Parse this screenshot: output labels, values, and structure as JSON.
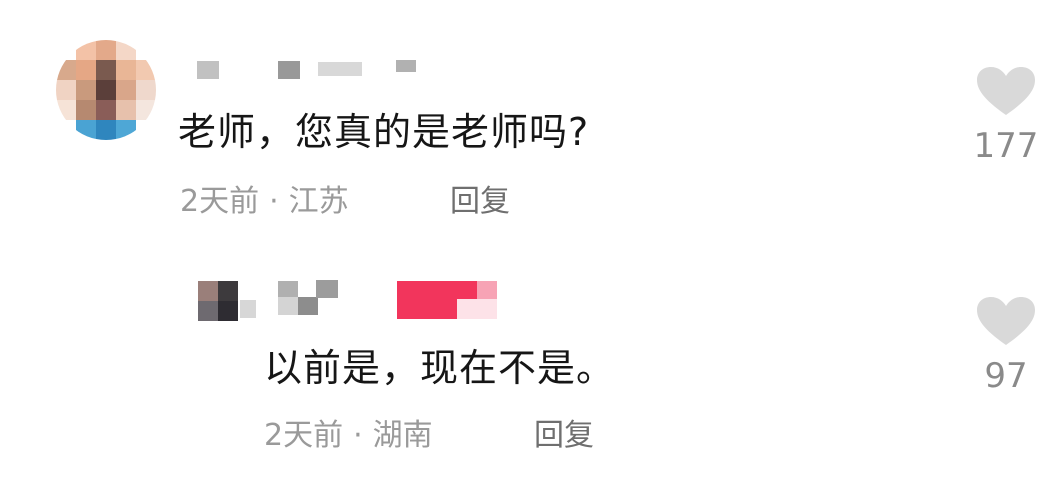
{
  "comments": [
    {
      "text": "老师，您真的是老师吗?",
      "time": "2天前",
      "location": "江苏",
      "separator": "·",
      "reply_label": "回复",
      "likes": "177",
      "avatar_icon": "blurred-avatar",
      "like_icon": "heart-icon"
    },
    {
      "text": "以前是，现在不是。",
      "time": "2天前",
      "location": "湖南",
      "separator": "·",
      "reply_label": "回复",
      "likes": "97",
      "avatar_icon": "blurred-avatar",
      "like_icon": "heart-icon"
    }
  ],
  "colors": {
    "heart": "#d9d9d9",
    "meta_text": "#9a9a9a",
    "author_tag": "#f2355c"
  }
}
